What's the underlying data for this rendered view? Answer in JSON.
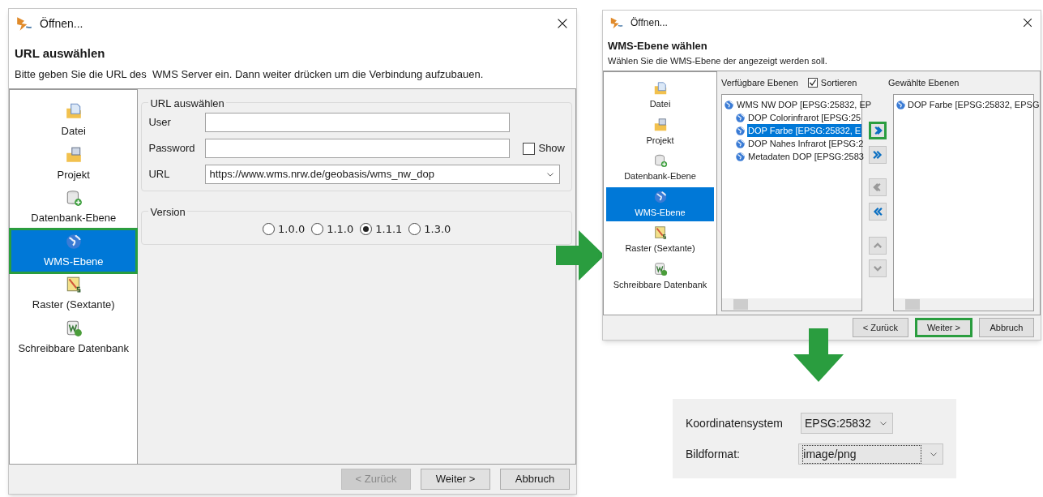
{
  "dialog_url": {
    "title": "Öffnen...",
    "heading": "URL auswählen",
    "description": "Bitte geben Sie die URL des  WMS Server ein. Dann weiter drücken um die Verbindung aufzubauen.",
    "sidebar": [
      {
        "kind": "file",
        "label": "Datei",
        "selected": false,
        "highlighted": false
      },
      {
        "kind": "project",
        "label": "Projekt",
        "selected": false,
        "highlighted": false
      },
      {
        "kind": "database",
        "label": "Datenbank-Ebene",
        "selected": false,
        "highlighted": false
      },
      {
        "kind": "globe",
        "label": "WMS-Ebene",
        "selected": true,
        "highlighted": true
      },
      {
        "kind": "raster",
        "label": "Raster (Sextante)",
        "selected": false,
        "highlighted": false
      },
      {
        "kind": "writable",
        "label": "Schreibbare Datenbank",
        "selected": false,
        "highlighted": false
      }
    ],
    "connection": {
      "legend": "URL auswählen",
      "fields": [
        {
          "kind": "text",
          "label": "User"
        },
        {
          "kind": "password",
          "label": "Password",
          "show": {
            "label": "Show",
            "checked": false
          }
        },
        {
          "kind": "combo",
          "label": "URL",
          "value": "https://www.wms.nrw.de/geobasis/wms_nw_dop"
        }
      ]
    },
    "version": {
      "legend": "Version",
      "options": [
        {
          "label": "1.0.0",
          "selected": false
        },
        {
          "label": "1.1.0",
          "selected": false
        },
        {
          "label": "1.1.1",
          "selected": true
        },
        {
          "label": "1.3.0",
          "selected": false
        }
      ]
    },
    "buttons": [
      {
        "label": "< Zurück",
        "disabled": true,
        "highlighted": false
      },
      {
        "label": "Weiter >",
        "disabled": false,
        "highlighted": false
      },
      {
        "label": "Abbruch",
        "disabled": false,
        "highlighted": false
      }
    ]
  },
  "dialog_layer": {
    "title": "Öffnen...",
    "heading": "WMS-Ebene wählen",
    "description": "Wählen Sie die WMS-Ebene der angezeigt werden soll.",
    "sidebar": [
      {
        "kind": "file",
        "label": "Datei",
        "selected": false
      },
      {
        "kind": "project",
        "label": "Projekt",
        "selected": false
      },
      {
        "kind": "database",
        "label": "Datenbank-Ebene",
        "selected": false
      },
      {
        "kind": "globe",
        "label": "WMS-Ebene",
        "selected": true
      },
      {
        "kind": "raster",
        "label": "Raster (Sextante)",
        "selected": false
      },
      {
        "kind": "writable",
        "label": "Schreibbare Datenbank",
        "selected": false
      }
    ],
    "available": {
      "label": "Verfügbare Ebenen",
      "sort": {
        "label": "Sortieren",
        "checked": true
      },
      "tree": [
        {
          "label": "WMS NW DOP [EPSG:25832, EP",
          "selected": false,
          "children": [
            {
              "label": "DOP Colorinfrarot [EPSG:25",
              "selected": false
            },
            {
              "label": "DOP Farbe [EPSG:25832, E",
              "selected": true
            },
            {
              "label": "DOP Nahes Infrarot [EPSG:2",
              "selected": false
            },
            {
              "label": "Metadaten DOP [EPSG:2583",
              "selected": false
            }
          ]
        }
      ]
    },
    "transfer": [
      {
        "kind": "add",
        "disabled": false,
        "highlighted": true
      },
      {
        "kind": "add-all",
        "disabled": false,
        "highlighted": false
      },
      {
        "kind": "remove",
        "disabled": true,
        "highlighted": false
      },
      {
        "kind": "remove-all",
        "disabled": false,
        "highlighted": false
      },
      {
        "kind": "up",
        "disabled": true,
        "highlighted": false
      },
      {
        "kind": "down",
        "disabled": true,
        "highlighted": false
      }
    ],
    "chosen": {
      "label": "Gewählte Ebenen",
      "items": [
        {
          "label": "DOP Farbe [EPSG:25832, EPSG"
        }
      ]
    },
    "buttons": [
      {
        "label": "< Zurück",
        "disabled": false,
        "highlighted": false
      },
      {
        "label": "Weiter >",
        "disabled": false,
        "highlighted": true
      },
      {
        "label": "Abbruch",
        "disabled": false,
        "highlighted": false
      }
    ]
  },
  "settings_panel": {
    "fields": [
      {
        "label": "Koordinatensystem",
        "value": "EPSG:25832",
        "focused": false
      },
      {
        "label": "Bildformat:",
        "value": "image/png",
        "focused": true
      }
    ]
  }
}
